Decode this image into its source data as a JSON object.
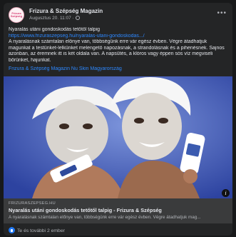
{
  "post": {
    "page_name": "Frizura & Szépség Magazin",
    "avatar_text": "Frizura Szépség",
    "date": "Augusztus 20. 11:07",
    "separator": "·",
    "more_icon": "more-horizontal-icon",
    "privacy_icon": "globe-icon",
    "text_lines": [
      "Nyaralás utáni gondoskodás tetőtől talpig",
      "A nyaralásnak számtalan előnye van, többségünk erre vár egész évben. Végre átadhatjuk",
      "magunkat a testünket-lelkünket melengető napozásnak, a strandolásnak és a pihenésnek. Sajnos",
      "azonban, az éremnek itt is két oldala van. A napsütés, a klóros vagy éppen sós víz megviseli",
      "bőrünket, hajunkat."
    ],
    "url": "https://www.frizuraszepseg.hu/nyaralas-utani-gondoskodas.../",
    "hashtag": "Frizura & Szépség Magazin Nu Skin Magyarország"
  },
  "link_preview": {
    "domain": "FRIZURASZEPSEG.HU",
    "title": "Nyaralás utáni gondoskodás tetőtől talpig - Frizura & Szépség",
    "description": "A nyaralásnak számtalan előnye van, többségünk erre vár egész évben. Végre átadhatjuk mag...",
    "info_icon": "info-icon"
  },
  "reactions": {
    "icon": "like-icon",
    "text": "Te és további 2 ember"
  },
  "colors": {
    "background": "#18191a",
    "card": "#242526",
    "link": "#2d88ff",
    "like": "#2078f4"
  }
}
